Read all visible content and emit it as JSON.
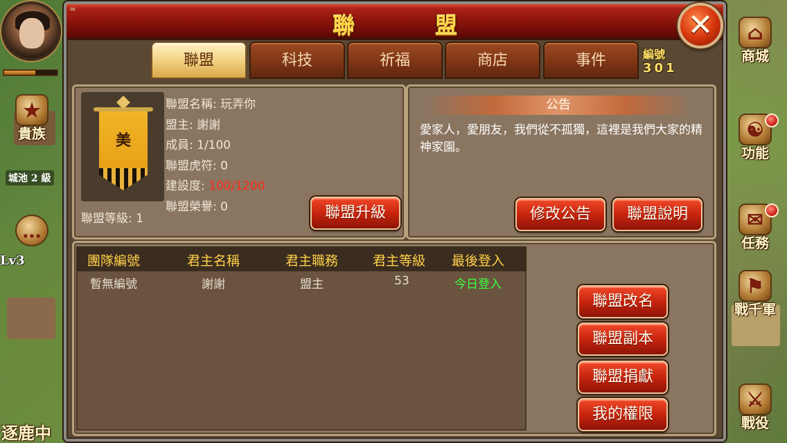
{
  "window": {
    "title": "聯　盟",
    "close_icon": "✕"
  },
  "tabs": [
    {
      "label": "聯盟",
      "active": true
    },
    {
      "label": "科技",
      "active": false
    },
    {
      "label": "祈福",
      "active": false
    },
    {
      "label": "商店",
      "active": false
    },
    {
      "label": "事件",
      "active": false
    }
  ],
  "serial": {
    "label": "編號",
    "number": "301"
  },
  "alliance": {
    "banner_char": "美",
    "level": "聯盟等級: 1",
    "name": "聯盟名稱: 玩弄你",
    "leader": "盟主: 謝謝",
    "members": "成員: 1/100",
    "tiger_tally": "聯盟虎符: 0",
    "construction_label": "建設度: ",
    "construction_value": "100/1200",
    "honor": "聯盟榮譽: 0",
    "upgrade_button": "聯盟升級"
  },
  "notice": {
    "title": "公告",
    "text": "愛家人，愛朋友，我們從不孤獨，這裡是我們大家的精神家園。",
    "edit_button": "修改公告",
    "explain_button": "聯盟說明"
  },
  "members_table": {
    "columns": [
      "團隊編號",
      "君主名稱",
      "君主職務",
      "君主等級",
      "最後登入"
    ],
    "rows": [
      [
        "暫無編號",
        "謝謝",
        "盟主",
        "53",
        "今日登入"
      ]
    ]
  },
  "actions": {
    "rename": "聯盟改名",
    "dungeon": "聯盟副本",
    "donate": "聯盟捐獻",
    "permissions": "我的權限"
  },
  "hud": {
    "left": {
      "noble_label": "貴族",
      "city_label": "城池 2 級",
      "level_label": "Lv3",
      "bottom_label": "逐鹿中"
    },
    "right": [
      {
        "label": "商城",
        "icon": "shop-icon"
      },
      {
        "label": "功能",
        "icon": "yin-yang-icon"
      },
      {
        "label": "任務",
        "icon": "scroll-icon"
      },
      {
        "label": "戰千軍",
        "icon": "map-icon"
      },
      {
        "label": "戰役",
        "icon": "swords-icon"
      }
    ]
  },
  "colors": {
    "title_gold": "#ffd84a",
    "button_red": "#c7240e",
    "online_green": "#3cff3c",
    "construction_red": "#ff2a1a"
  }
}
